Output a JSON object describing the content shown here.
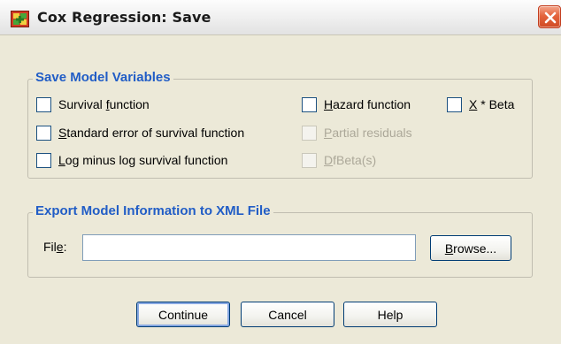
{
  "window": {
    "title": "Cox Regression: Save"
  },
  "save_model_variables": {
    "legend": "Save Model Variables",
    "checkboxes": [
      {
        "pre": "Survival ",
        "mn": "f",
        "post": "unction",
        "checked": false,
        "enabled": true
      },
      {
        "pre": "",
        "mn": "S",
        "post": "tandard error of survival function",
        "checked": false,
        "enabled": true
      },
      {
        "pre": "",
        "mn": "L",
        "post": "og minus log survival function",
        "checked": false,
        "enabled": true
      },
      {
        "pre": "",
        "mn": "H",
        "post": "azard function",
        "checked": false,
        "enabled": true
      },
      {
        "pre": "",
        "mn": "P",
        "post": "artial residuals",
        "checked": false,
        "enabled": false
      },
      {
        "pre": "",
        "mn": "D",
        "post": "fBeta(s)",
        "checked": false,
        "enabled": false
      },
      {
        "pre": "",
        "mn": "X",
        "post": " * Beta",
        "checked": false,
        "enabled": true
      }
    ]
  },
  "export": {
    "legend": "Export Model Information to XML File",
    "file_label_pre": "Fil",
    "file_label_mn": "e",
    "file_label_post": ":",
    "file_value": "",
    "browse_mn": "B",
    "browse_post": "rowse..."
  },
  "buttons": {
    "continue": "Continue",
    "cancel": "Cancel",
    "help": "Help"
  },
  "colors": {
    "legend": "#215dc6",
    "window_bg": "#ece9d8",
    "close": "#e4643d"
  }
}
